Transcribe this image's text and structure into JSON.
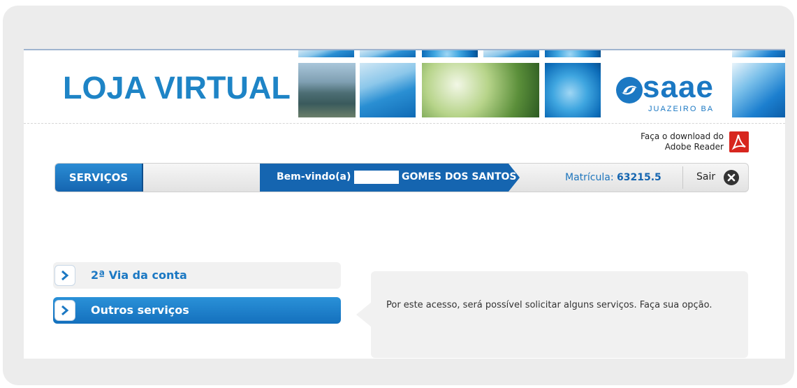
{
  "header": {
    "title": "LOJA VIRTUAL",
    "logo_text": "saae",
    "logo_subtext": "JUAZEIRO BA"
  },
  "adobe": {
    "line1": "Faça o download do",
    "line2": "Adobe Reader",
    "icon": "pdf-icon"
  },
  "nav": {
    "servicos": "SERVIÇOS",
    "welcome_label": "Bem-vindo(a)",
    "welcome_name": "GOMES DOS SANTOS",
    "matricula_label": "Matrícula:",
    "matricula_value": "63215.5",
    "sair": "Sair",
    "sair_icon": "close-icon"
  },
  "menu": {
    "items": [
      {
        "label": "2ª Via da conta",
        "active": false
      },
      {
        "label": "Outros serviços",
        "active": true
      }
    ]
  },
  "info": {
    "text": "Por este acesso, será possível solicitar alguns serviços. Faça sua opção."
  },
  "colors": {
    "brand_blue": "#1e84c6",
    "nav_blue": "#1565b0",
    "panel_gray": "#f1f1f1"
  }
}
